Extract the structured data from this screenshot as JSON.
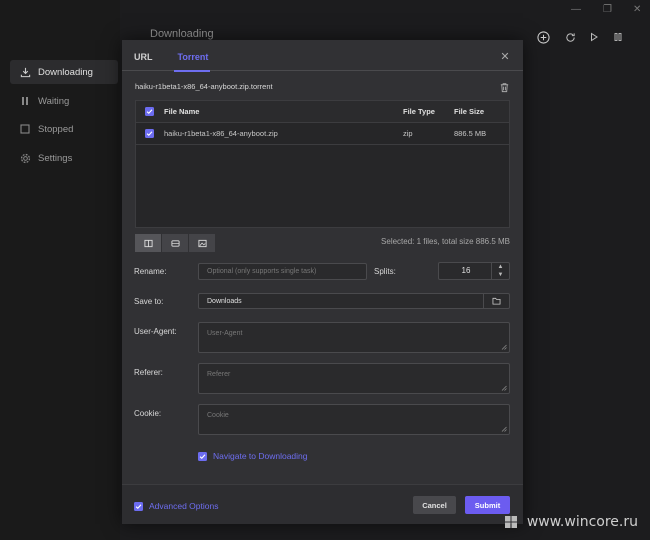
{
  "app": {
    "main_title": "Downloading",
    "sidebar": [
      {
        "label": "Downloading",
        "icon": "download-icon",
        "active": true
      },
      {
        "label": "Waiting",
        "icon": "pause-icon",
        "active": false
      },
      {
        "label": "Stopped",
        "icon": "stop-icon",
        "active": false
      },
      {
        "label": "Settings",
        "icon": "gear-icon",
        "active": false
      }
    ],
    "window_controls": {
      "minimize": "—",
      "maximize": "❐",
      "close": "✕"
    }
  },
  "dialog": {
    "tabs": [
      {
        "label": "URL",
        "active": false
      },
      {
        "label": "Torrent",
        "active": true
      }
    ],
    "torrent_file": "haiku-r1beta1-x86_64-anyboot.zip.torrent",
    "table": {
      "headers": {
        "name": "File Name",
        "type": "File Type",
        "size": "File Size"
      },
      "rows": [
        {
          "name": "haiku-r1beta1-x86_64-anyboot.zip",
          "type": "zip",
          "size": "886.5 MB",
          "checked": true
        }
      ]
    },
    "summary": "Selected: 1 files, total size 886.5 MB",
    "form": {
      "rename_label": "Rename:",
      "rename_placeholder": "Optional (only supports single task)",
      "splits_label": "Splits:",
      "splits_value": "16",
      "save_label": "Save to:",
      "save_value": "Downloads",
      "ua_label": "User-Agent:",
      "ua_placeholder": "User-Agent",
      "referer_label": "Referer:",
      "referer_placeholder": "Referer",
      "cookie_label": "Cookie:",
      "cookie_placeholder": "Cookie",
      "navigate_label": "Navigate to Downloading",
      "navigate_checked": true
    },
    "footer": {
      "advanced_label": "Advanced Options",
      "advanced_checked": true,
      "cancel_label": "Cancel",
      "submit_label": "Submit"
    }
  },
  "watermark": "www.wincore.ru",
  "colors": {
    "accent": "#6e6ef0",
    "dialog_bg": "#313134",
    "app_bg": "#1c1c1e"
  }
}
